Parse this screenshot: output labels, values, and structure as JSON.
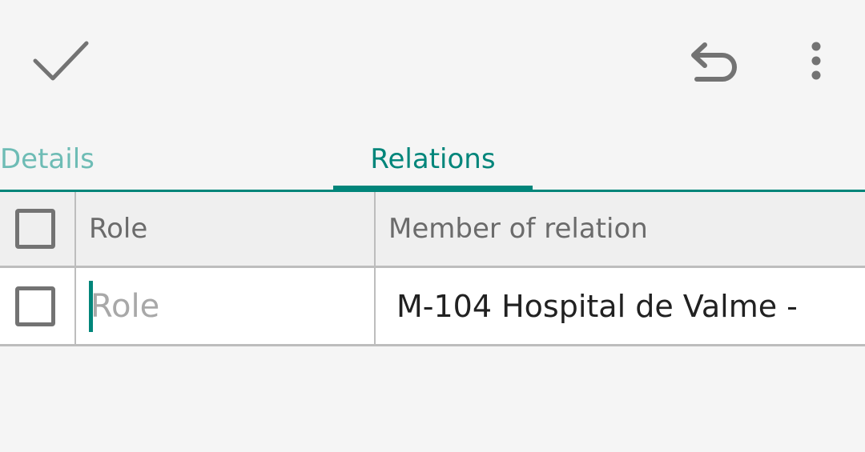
{
  "toolbar": {
    "confirm_icon": "check-icon",
    "undo_icon": "undo-icon",
    "menu_icon": "more-vertical-icon"
  },
  "tabs": [
    {
      "label": "Details",
      "selected": false
    },
    {
      "label": "Relations",
      "selected": true
    }
  ],
  "colors": {
    "accent": "#00857a",
    "accent_light": "#6ebcb5",
    "icon_gray": "#737373",
    "divider": "#bdbdbd"
  },
  "table": {
    "columns": [
      "Role",
      "Member of relation"
    ],
    "rows": [
      {
        "role_value": "",
        "role_placeholder": "Role",
        "member": "M-104 Hospital de Valme -"
      }
    ]
  }
}
